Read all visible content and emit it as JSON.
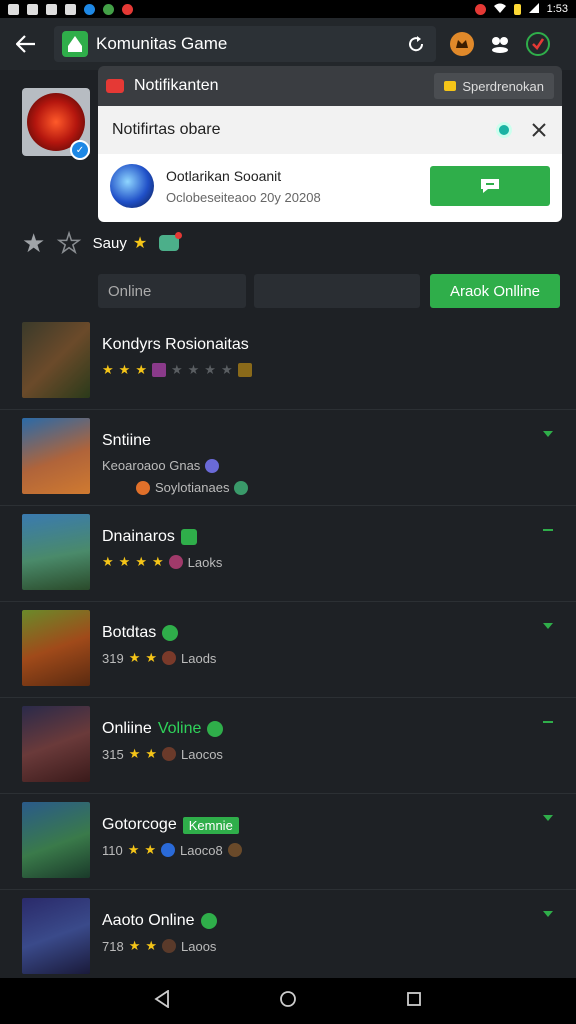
{
  "status_bar": {
    "time": "1:53"
  },
  "app_bar": {
    "title": "Komunitas Game"
  },
  "notification": {
    "header_title": "Notifikanten",
    "header_button": "Sperdrenokan",
    "card_title": "Notifirtas obare",
    "item_name": "Ootlarikan Sooanit",
    "item_sub": "Oclobeseiteaoo 20y 20208"
  },
  "rating": {
    "label": "Sauy"
  },
  "filter": {
    "placeholder": "Online",
    "button": "Araok Onlline"
  },
  "games": [
    {
      "title": "Kondyrs Rosionaitas",
      "sub": "",
      "sub2": "",
      "stars": 3,
      "tag": "",
      "highlight": ""
    },
    {
      "title": "Sntiine",
      "sub": "Keoaroaoo Gnas",
      "sub2": "Soylotianaes",
      "stars": 0,
      "tag": "",
      "highlight": ""
    },
    {
      "title": "Dnainaros",
      "sub": "Laoks",
      "sub2": "",
      "stars": 4,
      "tag": "",
      "highlight": ""
    },
    {
      "title": "Botdtas",
      "sub": "Laods",
      "sub2": "",
      "stars": 2,
      "count": "319",
      "tag": "",
      "highlight": ""
    },
    {
      "title": "Onliine",
      "sub": "Laocos",
      "sub2": "",
      "stars": 2,
      "count": "315",
      "tag": "",
      "highlight": "Voline"
    },
    {
      "title": "Gotorcoge",
      "sub": "Laoco8",
      "sub2": "",
      "stars": 2,
      "count": "110",
      "tag": "Kemnie",
      "highlight": ""
    },
    {
      "title": "Aaoto Online",
      "sub": "Laoos",
      "sub2": "",
      "stars": 2,
      "count": "718",
      "tag": "",
      "highlight": ""
    }
  ],
  "colors": {
    "accent": "#2fae4a",
    "background": "#1e2125"
  }
}
